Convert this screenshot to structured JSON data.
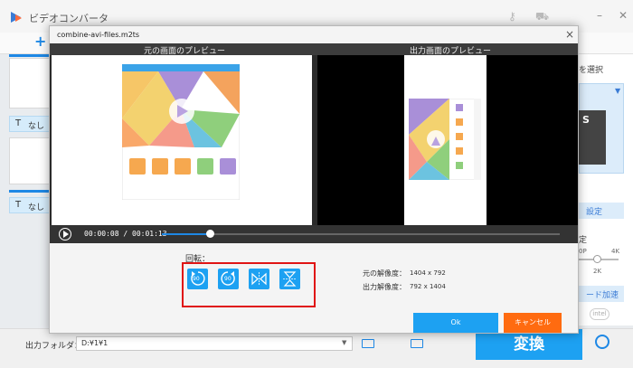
{
  "app": {
    "title": "ビデオコンバータ",
    "add_label": "+",
    "subtitle_none": "なし",
    "subtitle_t": "T"
  },
  "right_panel": {
    "select_label": "を選択",
    "format_label": "S",
    "settings_label": "設定",
    "settings2_label": "定",
    "tick_left": "0P",
    "tick_right": "4K",
    "res_value": "2K",
    "hw_accel_label": "ード加速",
    "intel_label": "intel"
  },
  "bottom": {
    "output_folder_label": "出力フォルダ：",
    "output_folder_value": "D:¥1¥1",
    "convert_label": "変換"
  },
  "dialog": {
    "file_name": "combine-avi-files.m2ts",
    "close": "×",
    "orig_preview_label": "元の画面のプレビュー",
    "out_preview_label": "出力画面のプレビュー",
    "time_current": "00:00:08",
    "time_separator": "/",
    "time_total": "00:01:13",
    "progress_fraction": 0.12,
    "rotate_label": "回転：",
    "buttons": {
      "rotate_left": "90",
      "rotate_right": "90"
    },
    "orig_res_label": "元の解像度：",
    "orig_res_value": "1404 x 792",
    "out_res_label": "出力解像度：",
    "out_res_value": "792 x 1404",
    "ok_label": "Ok",
    "cancel_label": "キャンセル"
  },
  "colors": {
    "accent": "#1da1f2",
    "cancel": "#ff6b10",
    "highlight": "#e01414"
  }
}
